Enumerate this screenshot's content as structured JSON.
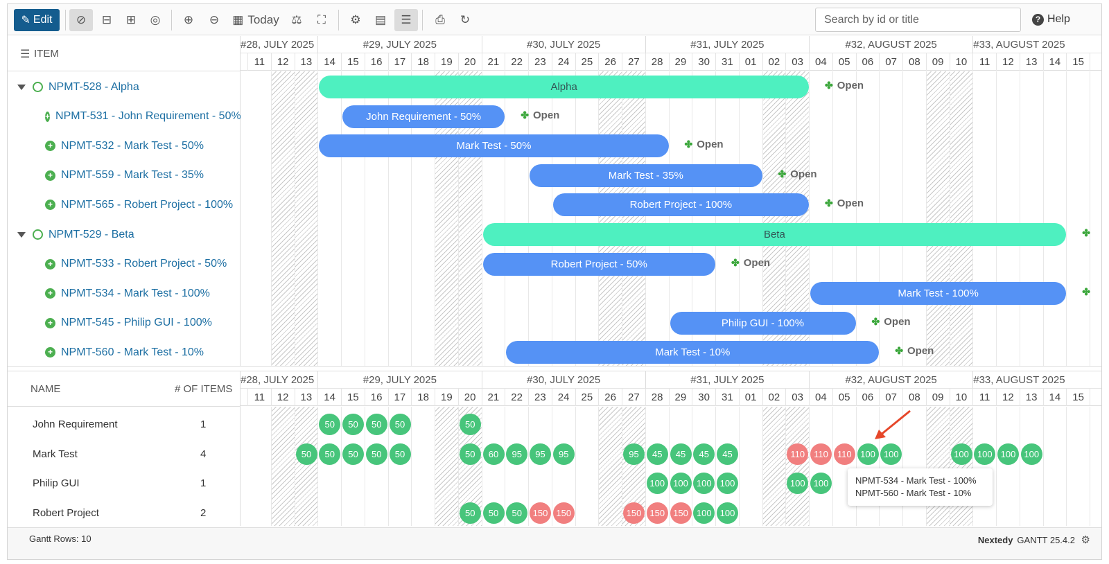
{
  "toolbar": {
    "edit_label": "Edit",
    "today_label": "Today",
    "search_placeholder": "Search by id or title",
    "help_label": "Help"
  },
  "top_panel": {
    "header_label": "ITEM",
    "weeks": [
      "#28, JULY 2025",
      "#29, JULY 2025",
      "#30, JULY 2025",
      "#31, JULY 2025",
      "#32, AUGUST 2025",
      "#33, AUGUST 2025"
    ],
    "days": [
      "11",
      "12",
      "13",
      "14",
      "15",
      "16",
      "17",
      "18",
      "19",
      "20",
      "21",
      "22",
      "23",
      "24",
      "25",
      "26",
      "27",
      "28",
      "29",
      "30",
      "31",
      "01",
      "02",
      "03",
      "04",
      "05",
      "06",
      "07",
      "08",
      "09",
      "10",
      "11",
      "12",
      "13",
      "14",
      "15"
    ],
    "rows": [
      {
        "label": "NPMT-528 - Alpha",
        "kind": "parent",
        "bar": "Alpha",
        "status": "Open"
      },
      {
        "label": "NPMT-531 - John Requirement - 50%",
        "kind": "child",
        "bar": "John Requirement - 50%",
        "status": "Open"
      },
      {
        "label": "NPMT-532 - Mark  Test - 50%",
        "kind": "child",
        "bar": "Mark Test - 50%",
        "status": "Open"
      },
      {
        "label": "NPMT-559 - Mark  Test - 35%",
        "kind": "child",
        "bar": "Mark Test - 35%",
        "status": "Open"
      },
      {
        "label": "NPMT-565 - Robert Project - 100%",
        "kind": "child",
        "bar": "Robert Project - 100%",
        "status": "Open"
      },
      {
        "label": "NPMT-529 - Beta",
        "kind": "parent",
        "bar": "Beta",
        "status": ""
      },
      {
        "label": "NPMT-533 - Robert Project - 50%",
        "kind": "child",
        "bar": "Robert Project - 50%",
        "status": "Open"
      },
      {
        "label": "NPMT-534 - Mark  Test - 100%",
        "kind": "child",
        "bar": "Mark Test - 100%",
        "status": ""
      },
      {
        "label": "NPMT-545 - Philip GUI - 100%",
        "kind": "child",
        "bar": "Philip GUI - 100%",
        "status": "Open"
      },
      {
        "label": "NPMT-560 - Mark  Test - 10%",
        "kind": "child",
        "bar": "Mark Test - 10%",
        "status": "Open"
      }
    ]
  },
  "bottom_panel": {
    "name_header": "NAME",
    "count_header": "# OF ITEMS",
    "resources": [
      {
        "name": "John Requirement",
        "count": "1",
        "cells": [
          {
            "d": 3,
            "v": "50"
          },
          {
            "d": 4,
            "v": "50"
          },
          {
            "d": 5,
            "v": "50"
          },
          {
            "d": 6,
            "v": "50"
          },
          {
            "d": 9,
            "v": "50"
          }
        ]
      },
      {
        "name": "Mark Test",
        "count": "4",
        "cells": [
          {
            "d": 2,
            "v": "50"
          },
          {
            "d": 3,
            "v": "50"
          },
          {
            "d": 4,
            "v": "50"
          },
          {
            "d": 5,
            "v": "50"
          },
          {
            "d": 6,
            "v": "50"
          },
          {
            "d": 9,
            "v": "50"
          },
          {
            "d": 10,
            "v": "60"
          },
          {
            "d": 11,
            "v": "95"
          },
          {
            "d": 12,
            "v": "95"
          },
          {
            "d": 13,
            "v": "95"
          },
          {
            "d": 16,
            "v": "95"
          },
          {
            "d": 17,
            "v": "45"
          },
          {
            "d": 18,
            "v": "45"
          },
          {
            "d": 19,
            "v": "45"
          },
          {
            "d": 20,
            "v": "45"
          },
          {
            "d": 23,
            "v": "110",
            "over": true
          },
          {
            "d": 24,
            "v": "110",
            "over": true
          },
          {
            "d": 25,
            "v": "110",
            "over": true
          },
          {
            "d": 26,
            "v": "100"
          },
          {
            "d": 27,
            "v": "100"
          },
          {
            "d": 30,
            "v": "100"
          },
          {
            "d": 31,
            "v": "100"
          },
          {
            "d": 32,
            "v": "100"
          },
          {
            "d": 33,
            "v": "100"
          }
        ]
      },
      {
        "name": "Philip GUI",
        "count": "1",
        "cells": [
          {
            "d": 17,
            "v": "100"
          },
          {
            "d": 18,
            "v": "100"
          },
          {
            "d": 19,
            "v": "100"
          },
          {
            "d": 20,
            "v": "100"
          },
          {
            "d": 23,
            "v": "100"
          },
          {
            "d": 24,
            "v": "100"
          }
        ]
      },
      {
        "name": "Robert Project",
        "count": "2",
        "cells": [
          {
            "d": 9,
            "v": "50"
          },
          {
            "d": 10,
            "v": "50"
          },
          {
            "d": 11,
            "v": "50"
          },
          {
            "d": 12,
            "v": "150",
            "over": true
          },
          {
            "d": 13,
            "v": "150",
            "over": true
          },
          {
            "d": 16,
            "v": "150",
            "over": true
          },
          {
            "d": 17,
            "v": "150",
            "over": true
          },
          {
            "d": 18,
            "v": "150",
            "over": true
          },
          {
            "d": 19,
            "v": "100"
          },
          {
            "d": 20,
            "v": "100"
          }
        ]
      }
    ]
  },
  "tooltip": {
    "line1": "NPMT-534 - Mark  Test - 100%",
    "line2": "NPMT-560 - Mark  Test - 10%"
  },
  "footer": {
    "rows_label": "Gantt Rows: 10",
    "brand": "Nextedy",
    "version": "GANTT 25.4.2"
  },
  "colors": {
    "accent": "#145c8e",
    "task_bar": "#5592f5",
    "group_bar": "#4ef0c0",
    "ok": "#47c57b",
    "over": "#f17f7f"
  }
}
